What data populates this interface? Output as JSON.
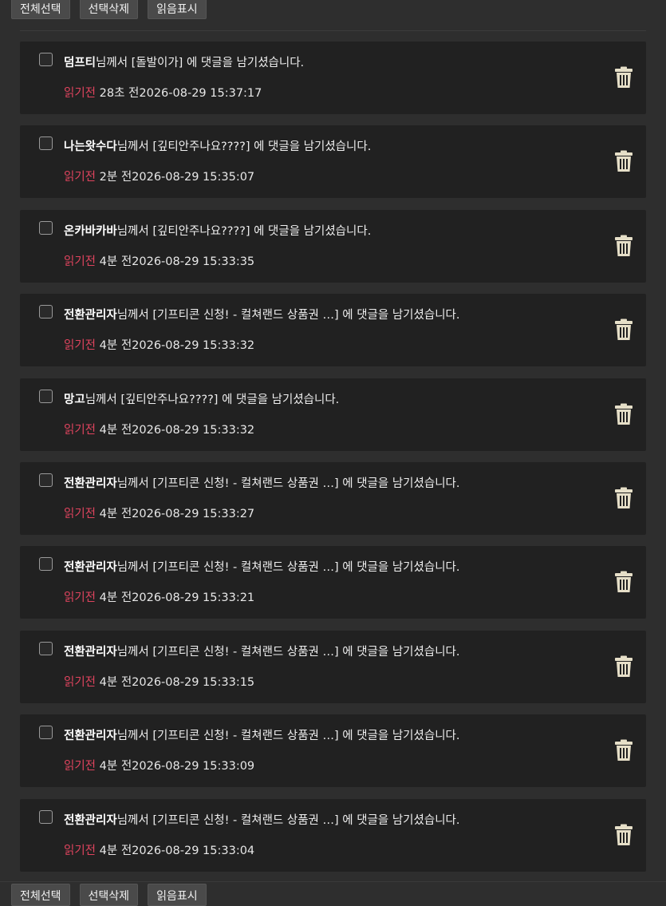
{
  "toolbar": {
    "select_all": "전체선택",
    "delete_selected": "선택삭제",
    "mark_read": "읽음표시"
  },
  "colors": {
    "background": "#2e2e2e",
    "card": "#212121",
    "unread": "#e0445e",
    "trash": "#e6dfc8"
  },
  "notifications": [
    {
      "nick": "덤프티",
      "text": "님께서 [돌발이가] 에 댓글을 남기셨습니다.",
      "status": "읽기전",
      "time": "28초 전2026-08-29 15:37:17"
    },
    {
      "nick": "나는왓수다",
      "text": "님께서 [깊티안주나요????] 에 댓글을 남기셨습니다.",
      "status": "읽기전",
      "time": "2분 전2026-08-29 15:35:07"
    },
    {
      "nick": "온카바카바",
      "text": "님께서 [깊티안주나요????] 에 댓글을 남기셨습니다.",
      "status": "읽기전",
      "time": "4분 전2026-08-29 15:33:35"
    },
    {
      "nick": "전환관리자",
      "text": "님께서 [기프티콘 신청! - 컬쳐랜드 상품권 …] 에 댓글을 남기셨습니다.",
      "status": "읽기전",
      "time": "4분 전2026-08-29 15:33:32"
    },
    {
      "nick": "망고",
      "text": "님께서 [깊티안주나요????] 에 댓글을 남기셨습니다.",
      "status": "읽기전",
      "time": "4분 전2026-08-29 15:33:32"
    },
    {
      "nick": "전환관리자",
      "text": "님께서 [기프티콘 신청! - 컬쳐랜드 상품권 …] 에 댓글을 남기셨습니다.",
      "status": "읽기전",
      "time": "4분 전2026-08-29 15:33:27"
    },
    {
      "nick": "전환관리자",
      "text": "님께서 [기프티콘 신청! - 컬쳐랜드 상품권 …] 에 댓글을 남기셨습니다.",
      "status": "읽기전",
      "time": "4분 전2026-08-29 15:33:21"
    },
    {
      "nick": "전환관리자",
      "text": "님께서 [기프티콘 신청! - 컬쳐랜드 상품권 …] 에 댓글을 남기셨습니다.",
      "status": "읽기전",
      "time": "4분 전2026-08-29 15:33:15"
    },
    {
      "nick": "전환관리자",
      "text": "님께서 [기프티콘 신청! - 컬쳐랜드 상품권 …] 에 댓글을 남기셨습니다.",
      "status": "읽기전",
      "time": "4분 전2026-08-29 15:33:09"
    },
    {
      "nick": "전환관리자",
      "text": "님께서 [기프티콘 신청! - 컬쳐랜드 상품권 …] 에 댓글을 남기셨습니다.",
      "status": "읽기전",
      "time": "4분 전2026-08-29 15:33:04"
    }
  ]
}
